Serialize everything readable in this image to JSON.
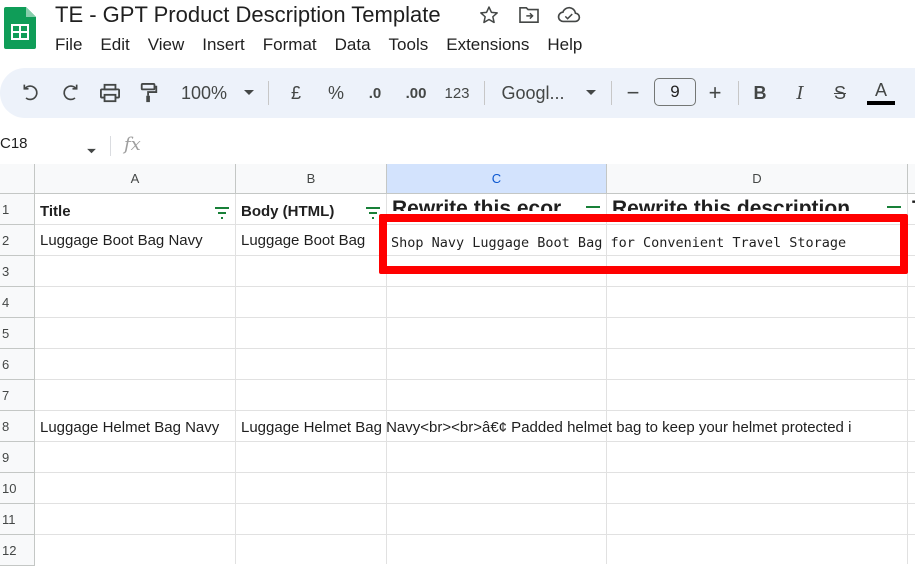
{
  "app": {
    "title": "TE - GPT Product Description Template"
  },
  "menu": [
    "File",
    "Edit",
    "View",
    "Insert",
    "Format",
    "Data",
    "Tools",
    "Extensions",
    "Help"
  ],
  "toolbar": {
    "zoom": "100%",
    "currency": "£",
    "percent": "%",
    "decrease_decimal": ".0",
    "increase_decimal": ".00",
    "number_format": "123",
    "font": "Googl...",
    "minus": "−",
    "font_size": "9",
    "plus": "+",
    "bold": "B",
    "italic": "I",
    "strike": "S",
    "text_color": "A"
  },
  "formula_bar": {
    "name_box": "C18",
    "fx": "fx"
  },
  "columns": [
    "A",
    "B",
    "C",
    "D"
  ],
  "rows": [
    "1",
    "2",
    "3",
    "4",
    "5",
    "6",
    "7",
    "8",
    "9",
    "10",
    "11",
    "12"
  ],
  "cells": {
    "A1": "Title",
    "B1": "Body (HTML)",
    "C1": "Rewrite this ecor",
    "D1": "Rewrite this description",
    "E1": "T",
    "A2": "Luggage Boot Bag Navy",
    "B2": "Luggage Boot Bag",
    "C2": "Shop Navy Luggage Boot Bag for Convenient Travel Storage",
    "A8": "Luggage Helmet Bag Navy",
    "B8": "Luggage Helmet Bag Navy<br><br>â€¢ Padded helmet bag to keep your helmet protected i"
  },
  "colors": {
    "highlight_border": "#ff0000",
    "selected_column_header": "#d3e3fd",
    "toolbar_bg": "#edf2fa",
    "logo_green": "#0f9d58"
  }
}
